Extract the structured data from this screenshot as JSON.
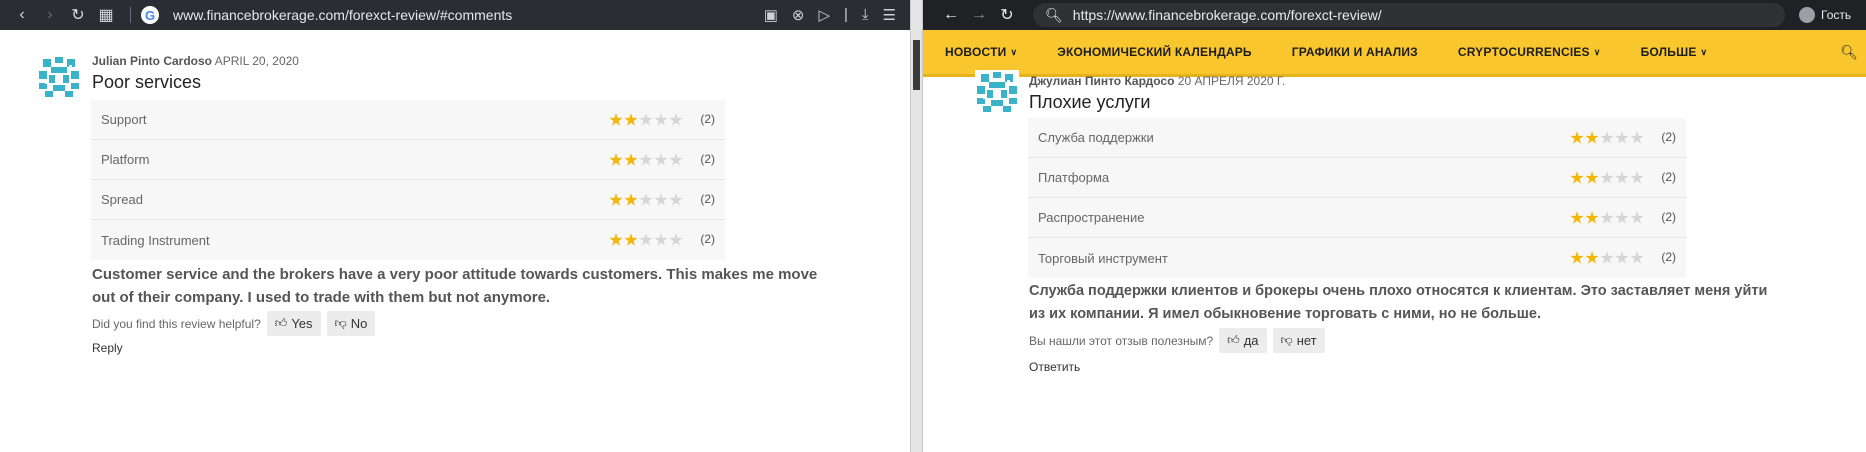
{
  "left": {
    "browser": {
      "url": "www.financebrokerage.com/forexct-review/#comments"
    },
    "review": {
      "author": "Julian Pinto Cardoso",
      "date": "APRIL 20, 2020",
      "title": "Poor services",
      "ratings": [
        {
          "label": "Support",
          "stars": 2,
          "count": "(2)"
        },
        {
          "label": "Platform",
          "stars": 2,
          "count": "(2)"
        },
        {
          "label": "Spread",
          "stars": 2,
          "count": "(2)"
        },
        {
          "label": "Trading Instrument",
          "stars": 2,
          "count": "(2)"
        }
      ],
      "body_line1": "Customer service and the brokers have a very poor attitude towards customers. This makes me move",
      "body_line2": "out of their company. I used to trade with them but not anymore.",
      "helpful_q": "Did you find this review helpful?",
      "yes": "Yes",
      "no": "No",
      "reply": "Reply"
    }
  },
  "right": {
    "browser": {
      "url": "https://www.financebrokerage.com/forexct-review/",
      "profile": "Гость"
    },
    "nav": [
      {
        "label": "НОВОСТИ",
        "dropdown": true
      },
      {
        "label": "ЭКОНОМИЧЕСКИЙ КАЛЕНДАРЬ",
        "dropdown": false
      },
      {
        "label": "ГРАФИКИ И АНАЛИЗ",
        "dropdown": false
      },
      {
        "label": "CRYPTOCURRENCIES",
        "dropdown": true
      },
      {
        "label": "БОЛЬШЕ",
        "dropdown": true
      }
    ],
    "review": {
      "author": "Джулиан Пинто Кардосо",
      "date": "20 АПРЕЛЯ 2020 Г.",
      "title": "Плохие услуги",
      "ratings": [
        {
          "label": "Служба поддержки",
          "stars": 2,
          "count": "(2)"
        },
        {
          "label": "Платформа",
          "stars": 2,
          "count": "(2)"
        },
        {
          "label": "Распространение",
          "stars": 2,
          "count": "(2)"
        },
        {
          "label": "Торговый инструмент",
          "stars": 2,
          "count": "(2)"
        }
      ],
      "body_line1": "Служба поддержки клиентов и брокеры очень плохо относятся к клиентам. Это заставляет меня уйти",
      "body_line2": "из их компании. Я имел обыкновение торговать с ними, но не больше.",
      "helpful_q": "Вы нашли этот отзыв полезным?",
      "yes": "да",
      "no": "нет",
      "reply": "Ответить"
    }
  },
  "colors": {
    "nav_bg": "#f9c62e",
    "star_on": "#f3b70a",
    "star_off": "#d6d6d6",
    "avatar": "#3ab3c9"
  }
}
